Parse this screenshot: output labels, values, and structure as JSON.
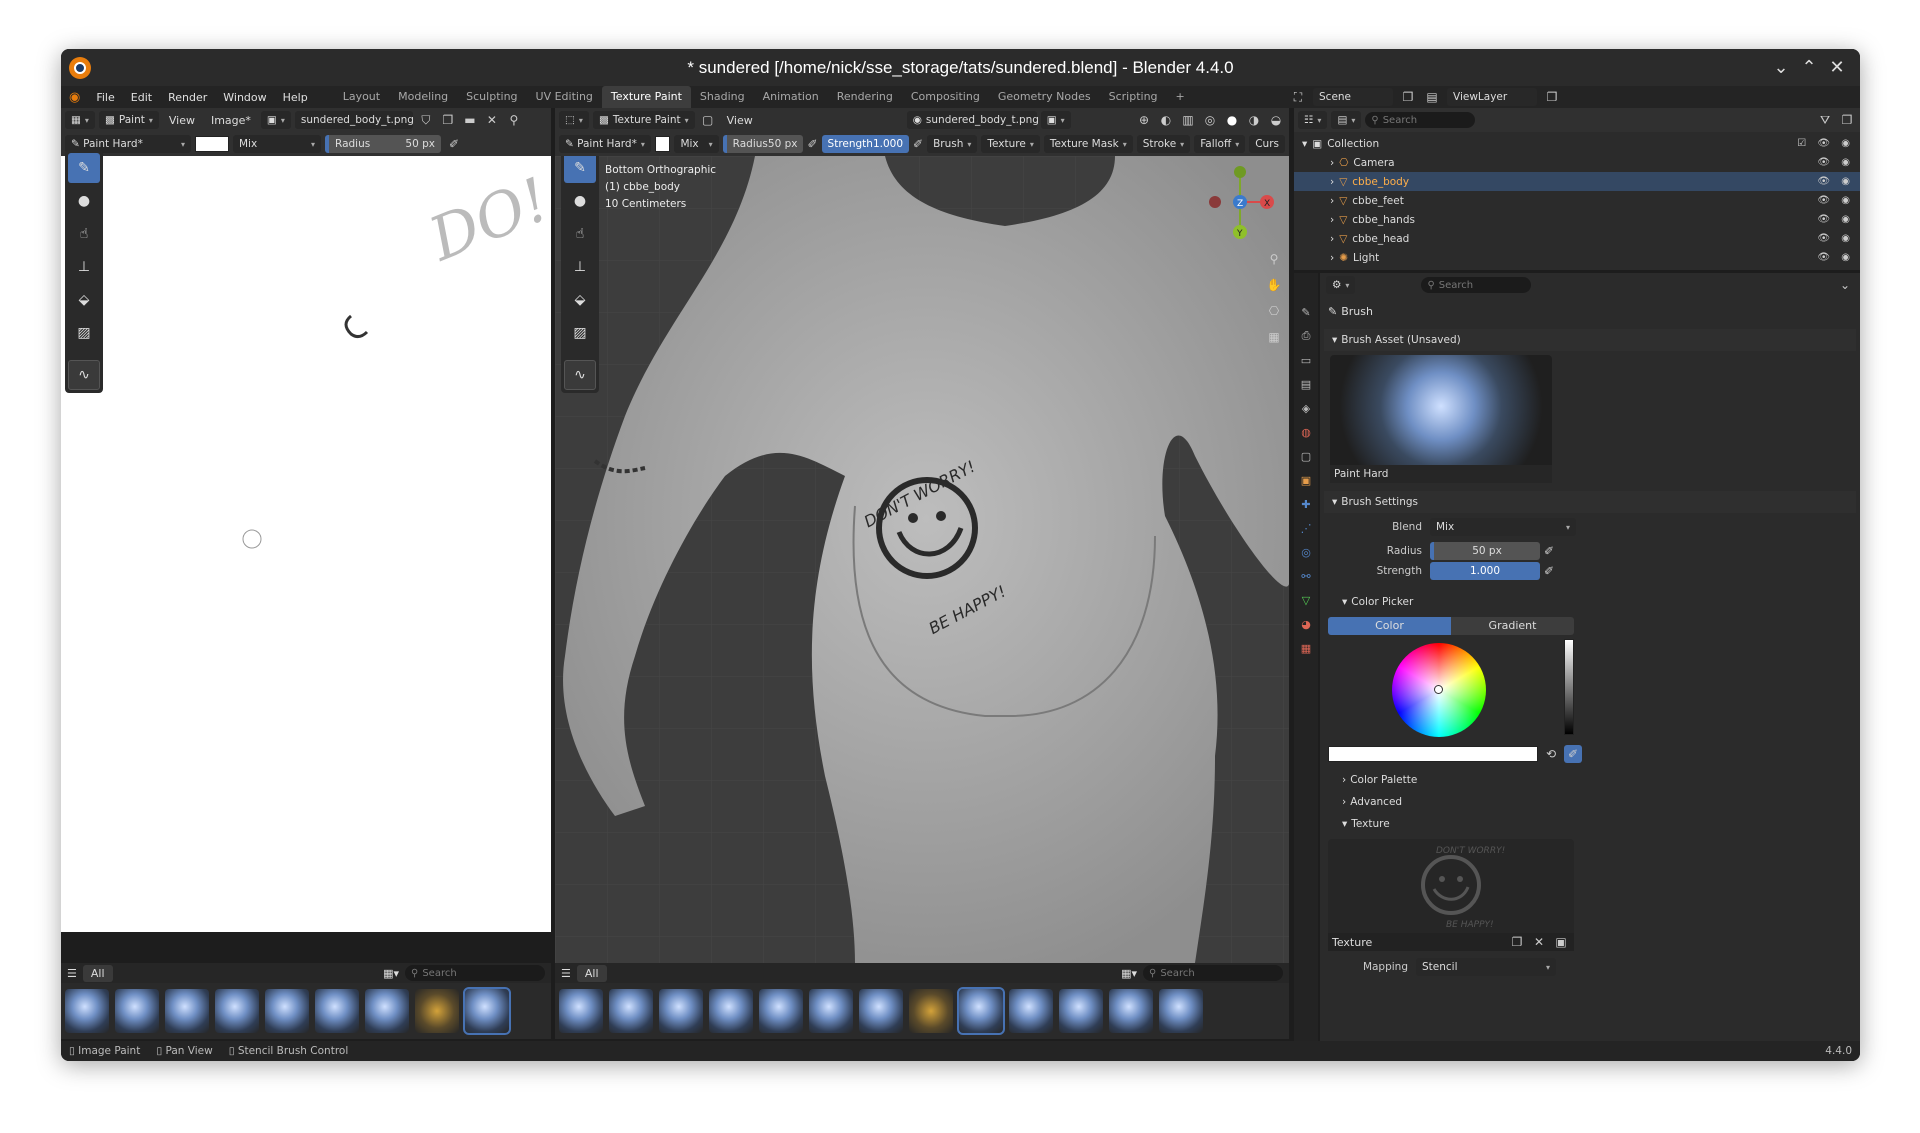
{
  "window": {
    "title": "* sundered [/home/nick/sse_storage/tats/sundered.blend] - Blender 4.4.0"
  },
  "menu": [
    "File",
    "Edit",
    "Render",
    "Window",
    "Help"
  ],
  "workspaces": [
    "Layout",
    "Modeling",
    "Sculpting",
    "UV Editing",
    "Texture Paint",
    "Shading",
    "Animation",
    "Rendering",
    "Compositing",
    "Geometry Nodes",
    "Scripting"
  ],
  "active_workspace": "Texture Paint",
  "scene": {
    "name": "Scene",
    "view_layer": "ViewLayer"
  },
  "image_editor": {
    "mode": "Paint",
    "view": "View",
    "image_menu": "Image*",
    "image_name": "sundered_body_t.png",
    "brush": "Paint Hard*",
    "blend": "Mix",
    "radius_label": "Radius",
    "radius_value": "50 px",
    "shelf_tab": "All",
    "search_placeholder": "Search"
  },
  "viewport": {
    "mode": "Texture Paint",
    "view": "View",
    "image_name": "sundered_body_t.png",
    "brush": "Paint Hard*",
    "blend": "Mix",
    "radius_label": "Radius",
    "radius_value": "50 px",
    "strength_label": "Strength",
    "strength_value": "1.000",
    "menus": [
      "Brush",
      "Texture",
      "Texture Mask",
      "Stroke",
      "Falloff",
      "Curs"
    ],
    "info": [
      "Bottom Orthographic",
      "(1) cbbe_body",
      "10 Centimeters"
    ],
    "tattoo_top": "DON'T WORRY!",
    "tattoo_bottom": "BE HAPPY!",
    "shelf_tab": "All",
    "search_placeholder": "Search",
    "axes": {
      "x": "X",
      "y": "Y",
      "z": "Z"
    }
  },
  "outliner": {
    "search_placeholder": "Search",
    "collection": "Collection",
    "items": [
      {
        "name": "Camera"
      },
      {
        "name": "cbbe_body",
        "selected": true
      },
      {
        "name": "cbbe_feet"
      },
      {
        "name": "cbbe_hands"
      },
      {
        "name": "cbbe_head"
      },
      {
        "name": "Light"
      }
    ]
  },
  "properties": {
    "search_placeholder": "Search",
    "context": "Brush",
    "brush_asset_panel": "Brush Asset (Unsaved)",
    "brush_asset_name": "Paint Hard",
    "brush_settings_panel": "Brush Settings",
    "blend_label": "Blend",
    "blend_value": "Mix",
    "radius_label": "Radius",
    "radius_value": "50 px",
    "strength_label": "Strength",
    "strength_value": "1.000",
    "color_picker_panel": "Color Picker",
    "color_tab": "Color",
    "gradient_tab": "Gradient",
    "color_palette_panel": "Color Palette",
    "advanced_panel": "Advanced",
    "texture_panel": "Texture",
    "texture_name": "Texture",
    "mapping_label": "Mapping",
    "mapping_value": "Stencil",
    "tex_top": "DON'T WORRY!",
    "tex_bottom": "BE HAPPY!"
  },
  "statusbar": {
    "items": [
      "Image Paint",
      "Pan View",
      "Stencil Brush Control"
    ],
    "version": "4.4.0"
  },
  "colors": {
    "accent": "#4772b3",
    "selected_row": "#344863",
    "viewport_bg": "#3d3d3d",
    "logo": "#e87d0d"
  }
}
